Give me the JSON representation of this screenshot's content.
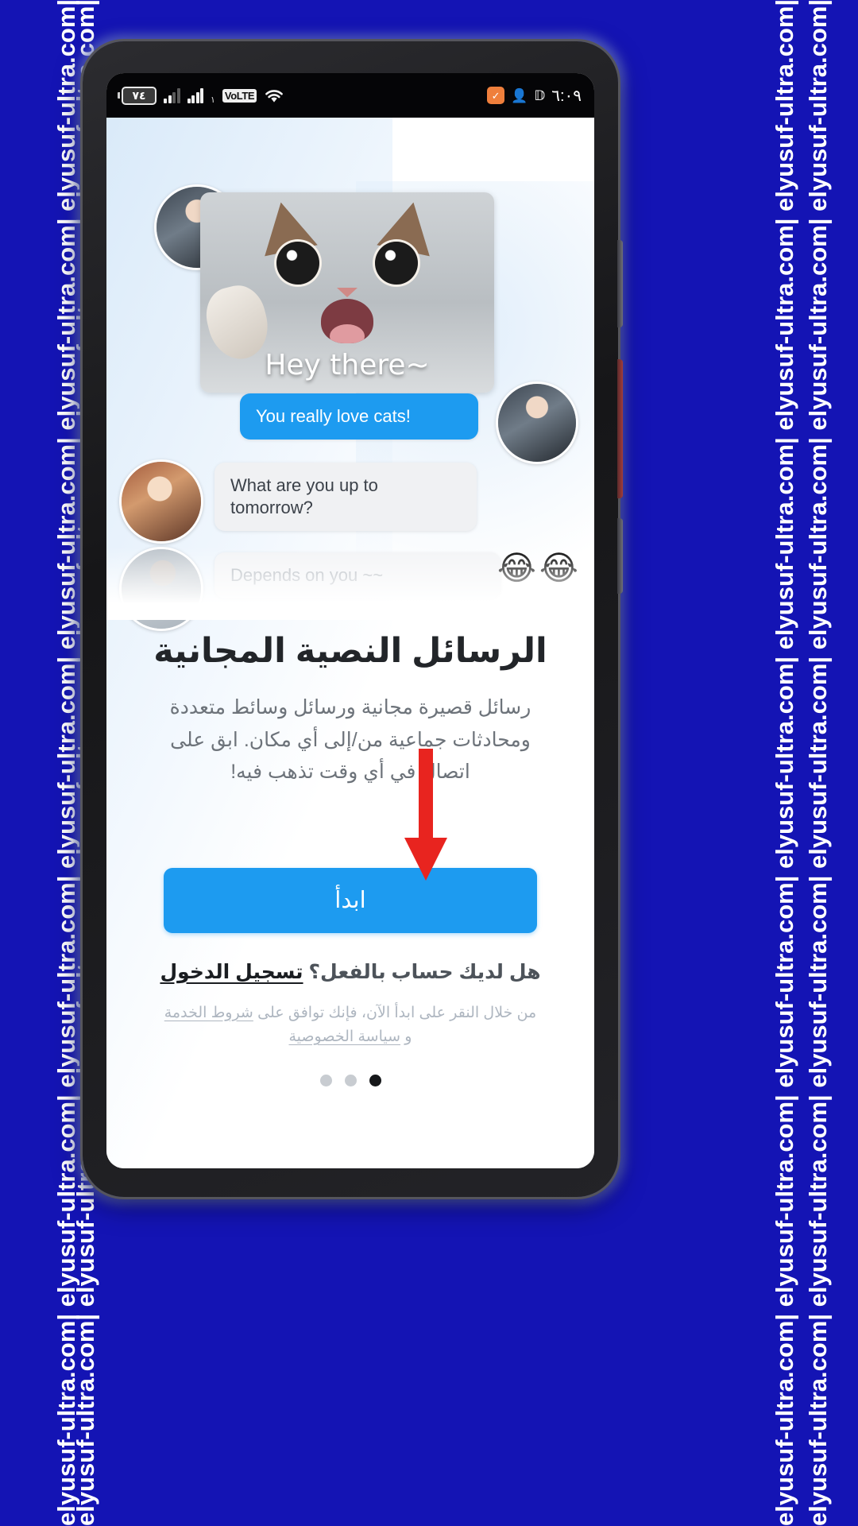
{
  "watermark": {
    "text": "elyusuf-ultra.com|",
    "repeat": "elyusuf-ultra.com| elyusuf-ultra.com| elyusuf-ultra.com| elyusuf-ultra.com| elyusuf-ultra.com| elyusuf-ultra.com| elyusuf-ultra.com| elyusuf-ultra.com|"
  },
  "colors": {
    "frame_blue": "#1414b4",
    "accent_blue": "#1d9bf0",
    "arrow_red": "#e8241f",
    "status_bar": "#050507",
    "headline": "#222529",
    "body_text": "#6d737a",
    "terms_text": "#aeb6c0"
  },
  "statusbar": {
    "battery_level": "٧٤",
    "sim_label": "١",
    "volte": "VoLTE",
    "time": "٦:٠٩",
    "icons": {
      "battery": "battery-icon",
      "signal_sim1": "signal-bars-icon",
      "signal_sim2": "signal-bars-icon",
      "volte": "volte-icon",
      "wifi": "wifi-icon",
      "notification_orange": "orange-app-notification-icon",
      "contacts": "contacts-icon",
      "x_app": "x-app-icon"
    }
  },
  "hero": {
    "cat_caption": "Hey there~",
    "bubbles": [
      {
        "id": "b1",
        "text": "You really love cats!",
        "style": "blue"
      },
      {
        "id": "b2",
        "text": "What are you up to tomorrow?",
        "style": "gray"
      },
      {
        "id": "b3",
        "text": "Depends on you ~~",
        "style": "faded"
      }
    ],
    "emojis": "😂😂"
  },
  "main": {
    "headline": "الرسائل النصية المجانية",
    "subtext": "رسائل قصيرة مجانية ورسائل وسائط متعددة ومحادثات جماعية من/إلى أي مكان. ابق على اتصال في أي وقت تذهب فيه!",
    "cta_label": "ابدأ",
    "login_prompt": "هل لديك حساب بالفعل؟",
    "login_link": "تسجيل الدخول",
    "terms_prefix": "من خلال النقر على ابدأ الآن، فإنك توافق على",
    "terms_of_service": "شروط الخدمة",
    "terms_conjunction": "و",
    "privacy_policy": "سياسة الخصوصية"
  },
  "pagination": {
    "total": 3,
    "active_index": 2
  }
}
